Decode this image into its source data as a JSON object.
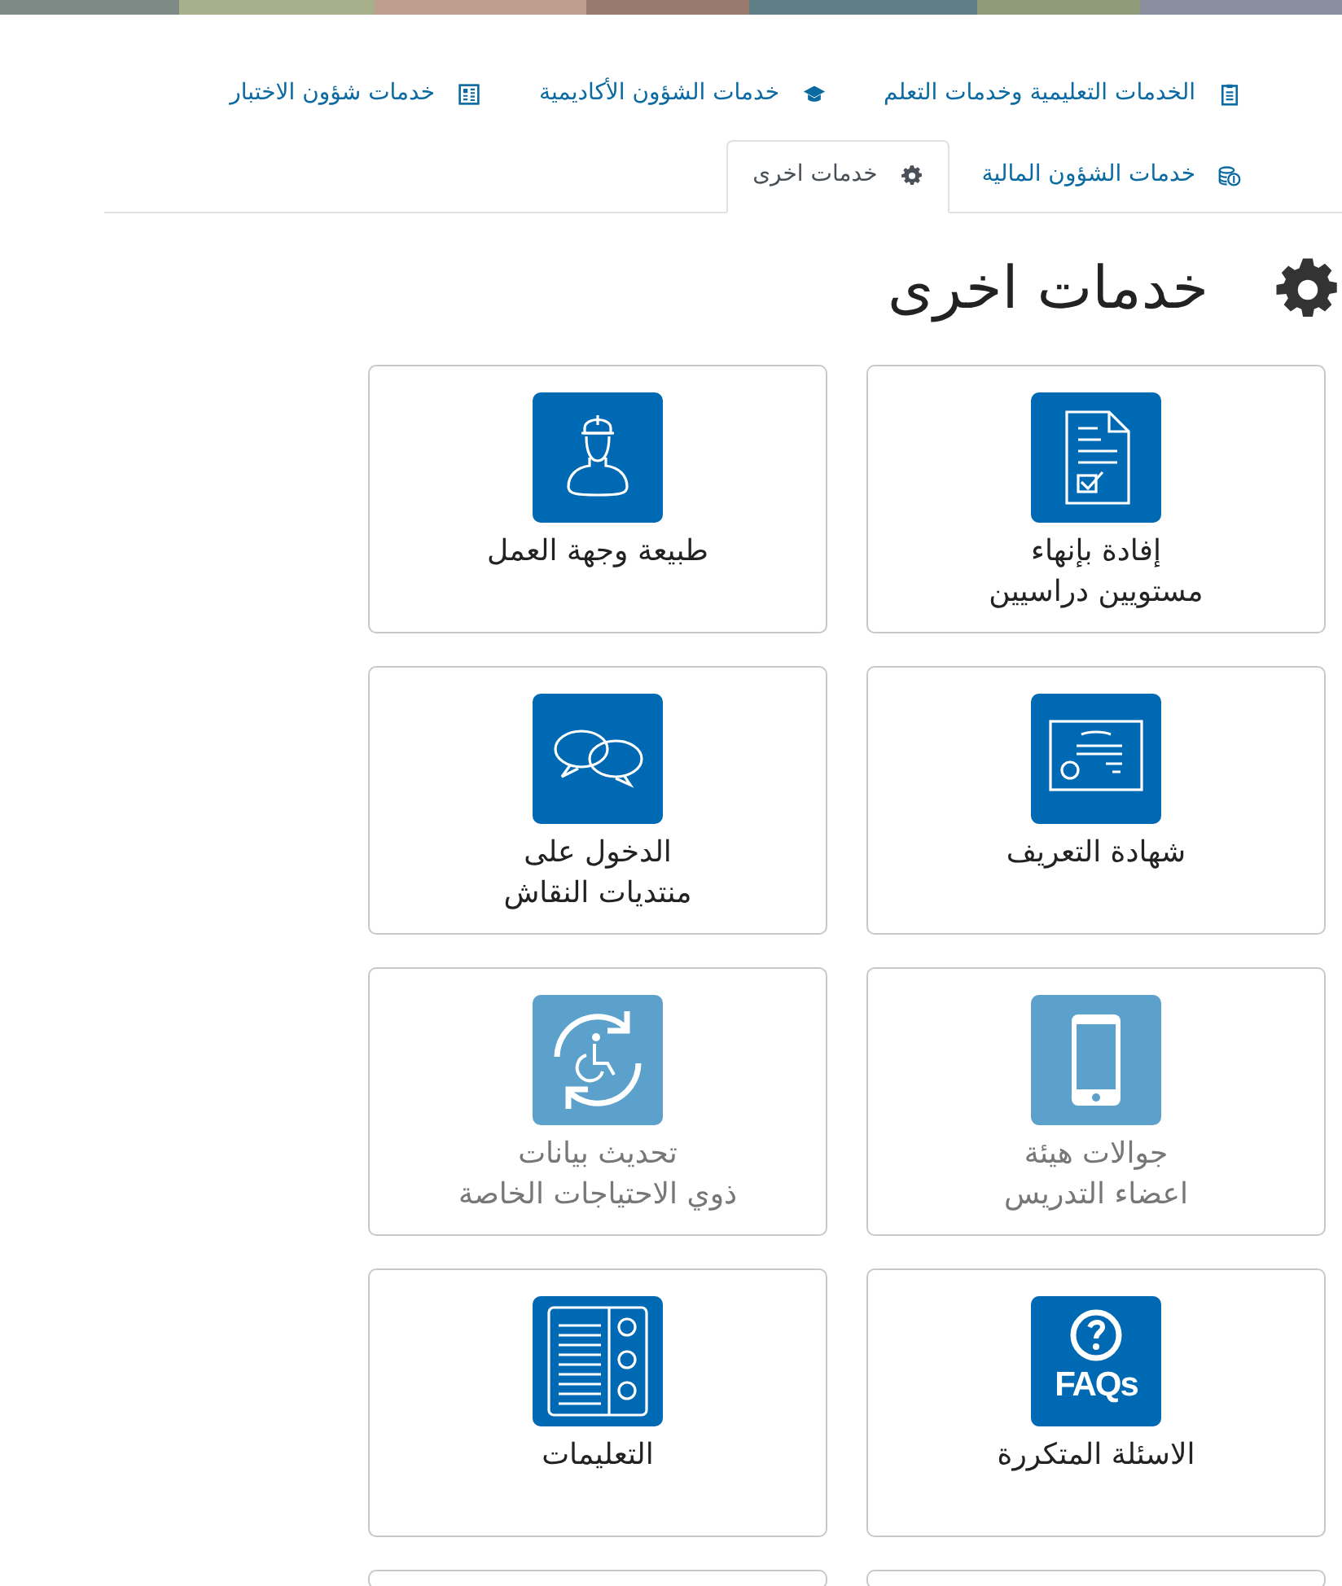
{
  "tabs": [
    {
      "label": "الخدمات التعليمية وخدمات التعلم",
      "selected": false
    },
    {
      "label": "خدمات الشؤون الأكاديمية",
      "selected": false
    },
    {
      "label": "خدمات شؤون الاختبار",
      "selected": false
    },
    {
      "label": "خدمات الشؤون المالية",
      "selected": false
    },
    {
      "label": "خدمات اخرى",
      "selected": true
    }
  ],
  "heading": "خدمات اخرى",
  "cards": [
    {
      "lines": [
        "إفادة بإنهاء",
        "مستويين دراسيين"
      ],
      "disabled": false
    },
    {
      "lines": [
        "طبيعة وجهة العمل"
      ],
      "disabled": false
    },
    {
      "lines": [
        "شهادة التعريف"
      ],
      "disabled": false
    },
    {
      "lines": [
        "الدخول على",
        "منتديات النقاش"
      ],
      "disabled": false
    },
    {
      "lines": [
        "جوالات هيئة",
        "اعضاء التدريس"
      ],
      "disabled": true
    },
    {
      "lines": [
        "تحديث بيانات",
        "ذوي الاحتياجات الخاصة"
      ],
      "disabled": true
    },
    {
      "lines": [
        "الاسئلة المتكررة"
      ],
      "disabled": false,
      "icon_text": "FAQs"
    },
    {
      "lines": [
        "التعليمات"
      ],
      "disabled": false
    }
  ]
}
